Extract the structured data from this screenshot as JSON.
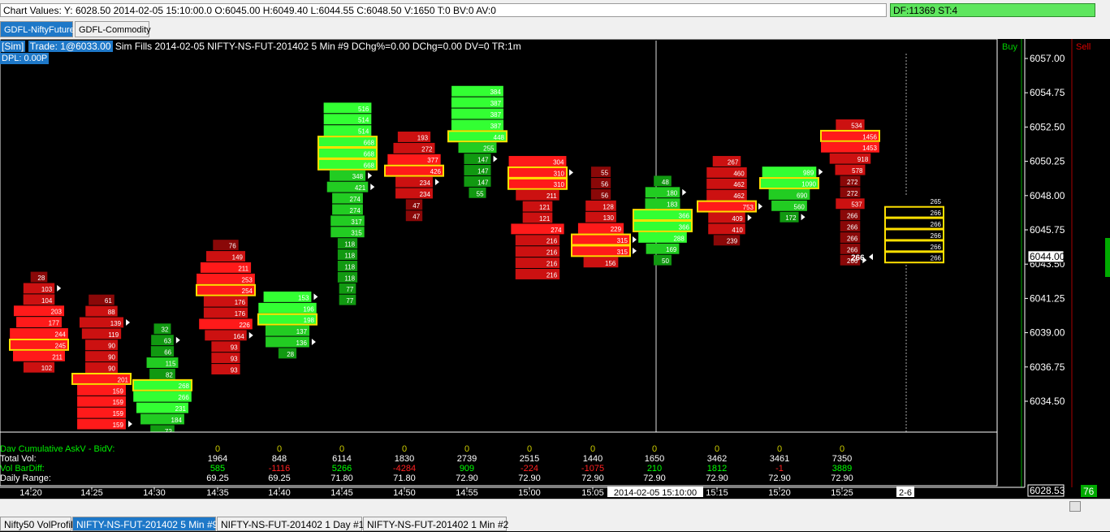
{
  "top_bar": {
    "chart_values": "Chart Values: Y: 6028.50  2014-02-05  15:10:00.0  O:6045.00  H:6049.40  L:6044.55  C:6048.50  V:1650  T:0  BV:0  AV:0",
    "df_status": "DF:11369  ST:4"
  },
  "top_tabs": [
    {
      "label": "GDFL-NiftyFuture",
      "active": true
    },
    {
      "label": "GDFL-Commodity",
      "active": false
    }
  ],
  "info": {
    "sim": "[Sim]",
    "trade": "Trade: 1@6033.00",
    "details": " Sim Fills  2014-02-05 NIFTY-NS-FUT-201402  5 Min  #9 DChg%=0.00 DChg=0.00 DV=0 TR:1m",
    "dpl": "DPL: 0.00P"
  },
  "chart_data": {
    "type": "footprint",
    "symbol": "NIFTY-NS-FUT-201402",
    "interval": "5 Min",
    "y_axis": {
      "labels": [
        "6057.00",
        "6054.75",
        "6052.50",
        "6050.25",
        "6048.00",
        "6045.75",
        "6043.50",
        "6041.25",
        "6039.00",
        "6036.75",
        "6034.50"
      ],
      "ylim": [
        6032.5,
        6057.6
      ],
      "current_price": "6044.00",
      "crosshair_price": "6028.53"
    },
    "x_axis": {
      "labels": [
        "14:20",
        "14:25",
        "14:30",
        "14:35",
        "14:40",
        "14:45",
        "14:50",
        "14:55",
        "15:00",
        "15:05",
        "15:15",
        "15:20",
        "15:25"
      ],
      "crosshair_time": "2014-02-05  15:10:00",
      "right_label": "2-6"
    },
    "side_labels": {
      "buy": "Buy",
      "sell": "Sell"
    },
    "bars": [
      {
        "time": "14:20",
        "dir": "down",
        "top": 6043.0,
        "values": [
          28,
          103,
          104,
          203,
          177,
          244,
          245,
          211,
          102
        ],
        "highlight": [
          6
        ],
        "arrows": [
          1
        ]
      },
      {
        "time": "14:25",
        "dir": "down",
        "top": 6041.5,
        "values": [
          61,
          88,
          139,
          119,
          90,
          90,
          90,
          201,
          159,
          159,
          159,
          159
        ],
        "highlight": [
          7
        ],
        "arrows": [
          2,
          11
        ]
      },
      {
        "time": "14:30",
        "dir": "up",
        "top": 6039.6,
        "values": [
          32,
          63,
          66,
          115,
          82,
          268,
          266,
          231,
          184,
          72
        ],
        "highlight": [
          5
        ],
        "arrows": [
          1
        ]
      },
      {
        "time": "14:35",
        "dir": "down",
        "top": 6045.1,
        "values": [
          76,
          149,
          211,
          253,
          254,
          176,
          176,
          226,
          164,
          93,
          93,
          93
        ],
        "highlight": [
          4
        ],
        "arrows": [
          8
        ]
      },
      {
        "time": "14:40",
        "dir": "up",
        "top": 6041.7,
        "values": [
          153,
          196,
          198,
          137,
          136,
          28
        ],
        "highlight": [
          2
        ],
        "arrows": [
          0,
          4
        ]
      },
      {
        "time": "14:45",
        "dir": "up",
        "top": 6054.1,
        "values": [
          516,
          514,
          514,
          668,
          668,
          668,
          348,
          421,
          274,
          274,
          317,
          315,
          118,
          118,
          118,
          118,
          77,
          77
        ],
        "highlight": [
          3,
          4,
          5
        ],
        "arrows": [
          6,
          7
        ]
      },
      {
        "time": "14:50",
        "dir": "down",
        "top": 6052.2,
        "values": [
          193,
          272,
          377,
          426,
          234,
          234,
          47,
          47
        ],
        "highlight": [
          3
        ],
        "arrows": [
          4
        ]
      },
      {
        "time": "14:55",
        "dir": "up",
        "top": 6055.2,
        "values": [
          384,
          387,
          387,
          387,
          448,
          255,
          147,
          147,
          147,
          55
        ],
        "highlight": [
          4
        ],
        "arrows": [
          6
        ]
      },
      {
        "time": "15:00",
        "dir": "down",
        "top": 6050.6,
        "values": [
          304,
          310,
          310,
          211,
          121,
          121,
          274,
          216,
          216,
          216,
          216
        ],
        "highlight": [
          1,
          2
        ],
        "arrows": [
          1
        ]
      },
      {
        "time": "15:05",
        "dir": "down",
        "top": 6049.9,
        "values": [
          55,
          56,
          56,
          128,
          130,
          229,
          315,
          315,
          156
        ],
        "highlight": [
          6,
          7
        ],
        "arrows": [
          6,
          7
        ]
      },
      {
        "time": "15:10",
        "dir": "up",
        "top": 6049.3,
        "values": [
          48,
          180,
          183,
          366,
          366,
          288,
          169,
          50
        ],
        "highlight": [
          3,
          4
        ],
        "arrows": [
          1
        ]
      },
      {
        "time": "15:15",
        "dir": "down",
        "top": 6050.6,
        "values": [
          267,
          460,
          462,
          462,
          753,
          409,
          410,
          239
        ],
        "highlight": [
          4
        ],
        "arrows": [
          4,
          5
        ]
      },
      {
        "time": "15:20",
        "dir": "up",
        "top": 6049.9,
        "values": [
          989,
          1090,
          690,
          560,
          172
        ],
        "highlight": [
          1
        ],
        "arrows": [
          0,
          4
        ]
      },
      {
        "time": "15:25",
        "dir": "down",
        "top": 6053.0,
        "values": [
          534,
          1456,
          1453,
          918,
          578,
          272,
          272,
          537,
          266,
          266,
          266,
          266,
          266
        ],
        "highlight": [
          1
        ],
        "arrows": [
          12
        ]
      },
      {
        "time": "15:30",
        "dir": "live",
        "top": 6048.0,
        "values": [
          265,
          266,
          266,
          266,
          266,
          266
        ],
        "highlight": [
          1,
          2,
          3,
          4,
          5
        ],
        "arrows": []
      }
    ],
    "stats": {
      "row_labels": [
        "Dav Cumulative AskV - BidV:",
        "Total Vol:",
        "Vol BarDiff:",
        "Daily Range:"
      ],
      "columns": [
        {
          "cum": "0",
          "vol": "1964",
          "diff": "585",
          "range": "69.25"
        },
        {
          "cum": "0",
          "vol": "848",
          "diff": "-1116",
          "range": "69.25"
        },
        {
          "cum": "0",
          "vol": "6114",
          "diff": "5266",
          "range": "71.80"
        },
        {
          "cum": "0",
          "vol": "1830",
          "diff": "-4284",
          "range": "71.80"
        },
        {
          "cum": "0",
          "vol": "2739",
          "diff": "909",
          "range": "72.90"
        },
        {
          "cum": "0",
          "vol": "2515",
          "diff": "-224",
          "range": "72.90"
        },
        {
          "cum": "0",
          "vol": "1440",
          "diff": "-1075",
          "range": "72.90"
        },
        {
          "cum": "0",
          "vol": "1650",
          "diff": "210",
          "range": "72.90"
        },
        {
          "cum": "0",
          "vol": "3462",
          "diff": "1812",
          "range": "72.90"
        },
        {
          "cum": "0",
          "vol": "3461",
          "diff": "-1",
          "range": "72.90"
        },
        {
          "cum": "0",
          "vol": "7350",
          "diff": "3889",
          "range": "72.90"
        }
      ]
    },
    "bottom_right_value": "76"
  },
  "bottom_tabs": [
    {
      "label": "Nifty50 VolProfile",
      "active": false
    },
    {
      "label": "NIFTY-NS-FUT-201402  5 Min  #9",
      "active": true
    },
    {
      "label": "NIFTY-NS-FUT-201402  1 Day  #1",
      "active": false
    },
    {
      "label": "NIFTY-NS-FUT-201402  1 Min  #2",
      "active": false
    }
  ],
  "colors": {
    "buy": "#00cc00",
    "sell": "#cc0000",
    "highlight_border": "#ffe000",
    "axis": "#ffffff",
    "stats_green": "#00ff00",
    "stats_red": "#ff2020",
    "stats_yellow": "#cccc00"
  }
}
